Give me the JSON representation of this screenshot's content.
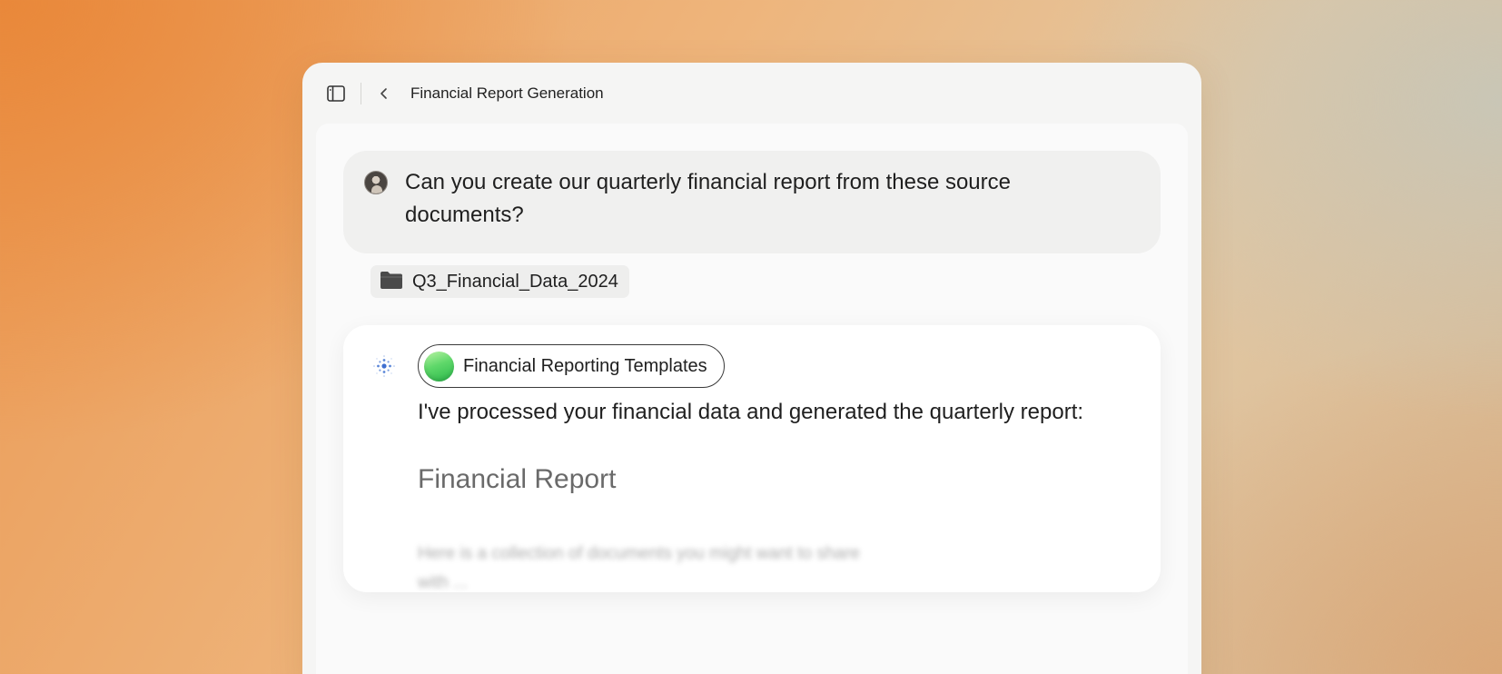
{
  "window": {
    "title": "Financial Report Generation"
  },
  "icons": {
    "sidebar": "sidebar-toggle-icon",
    "back": "chevron-left-icon",
    "folder": "folder-icon",
    "assistant": "sparkle-dots-icon"
  },
  "conversation": {
    "user_message": "Can you create our quarterly financial report from these source documents?",
    "attachment": "Q3_Financial_Data_2024",
    "assistant": {
      "source_chip": "Financial Reporting Templates",
      "message": "I've processed your financial data and generated the quarterly report:",
      "report_heading": "Financial Report",
      "report_preview": "Here is a collection of documents you might want to share with ..."
    }
  },
  "colors": {
    "accent_blue": "#4a7fd6",
    "chip_green": "#4cc95a"
  }
}
